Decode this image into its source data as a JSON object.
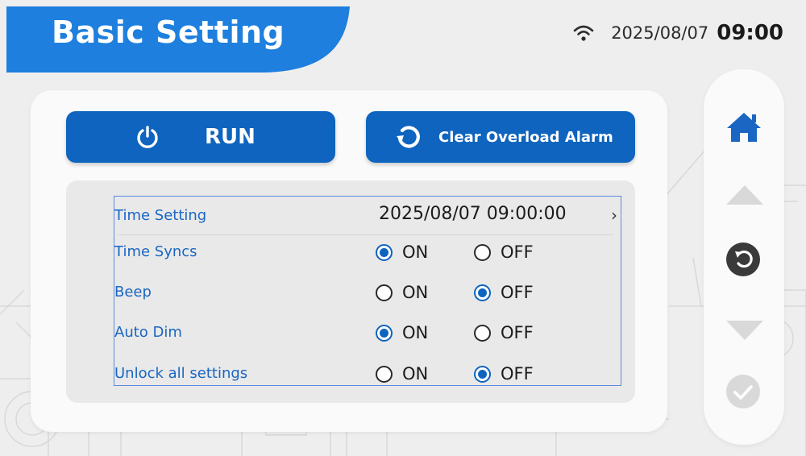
{
  "header": {
    "title": "Basic Setting",
    "wifi_icon": "wifi-icon",
    "date": "2025/08/07",
    "time": "09:00"
  },
  "actions": {
    "run": {
      "label": "RUN",
      "icon": "power-icon"
    },
    "clear": {
      "label": "Clear Overload Alarm",
      "icon": "refresh-icon"
    }
  },
  "settings": {
    "time_setting": {
      "label": "Time Setting",
      "value": "2025/08/07 09:00:00",
      "chevron": "›"
    },
    "time_syncs": {
      "label": "Time Syncs",
      "on_label": "ON",
      "off_label": "OFF",
      "selected": "ON"
    },
    "beep": {
      "label": "Beep",
      "on_label": "ON",
      "off_label": "OFF",
      "selected": "OFF"
    },
    "auto_dim": {
      "label": "Auto Dim",
      "on_label": "ON",
      "off_label": "OFF",
      "selected": "ON"
    },
    "unlock_all": {
      "label": "Unlock all settings",
      "on_label": "ON",
      "off_label": "OFF",
      "selected": "OFF"
    }
  },
  "sidebar": {
    "items": [
      "home-icon",
      "arrow-up-icon",
      "back-icon",
      "arrow-down-icon",
      "confirm-icon"
    ]
  },
  "colors": {
    "primary": "#0e64be",
    "header_blue": "#1e7fde",
    "label_blue": "#1a66c2",
    "disabled_gray": "#d9d9d9",
    "back_button": "#3a3a3a"
  }
}
